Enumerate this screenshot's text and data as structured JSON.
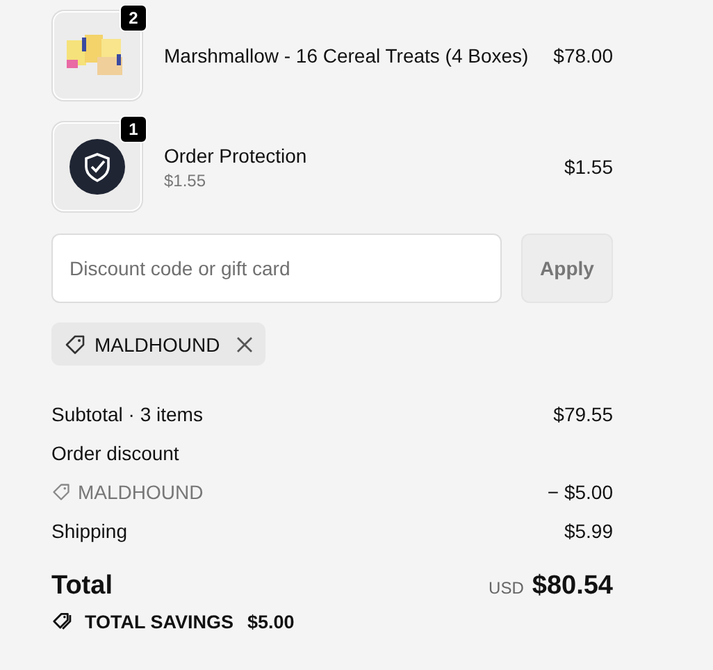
{
  "line_items": [
    {
      "kind": "product",
      "quantity": "2",
      "name": "Marshmallow - 16 Cereal Treats (4 Boxes)",
      "price": "$78.00"
    },
    {
      "kind": "protection",
      "quantity": "1",
      "name": "Order Protection",
      "subtitle": "$1.55",
      "price": "$1.55"
    }
  ],
  "discount": {
    "placeholder": "Discount code or gift card",
    "apply_label": "Apply",
    "apply_disabled": true,
    "applied_codes": [
      {
        "code": "MALDHOUND"
      }
    ]
  },
  "summary": {
    "subtotal_label": "Subtotal · 3 items",
    "subtotal": "$79.55",
    "discount_label": "Order discount",
    "discount_code": "MALDHOUND",
    "discount_amount": "− $5.00",
    "shipping_label": "Shipping",
    "shipping": "$5.99",
    "total_label": "Total",
    "currency": "USD",
    "total": "$80.54",
    "savings_label": "TOTAL SAVINGS",
    "savings": "$5.00"
  }
}
